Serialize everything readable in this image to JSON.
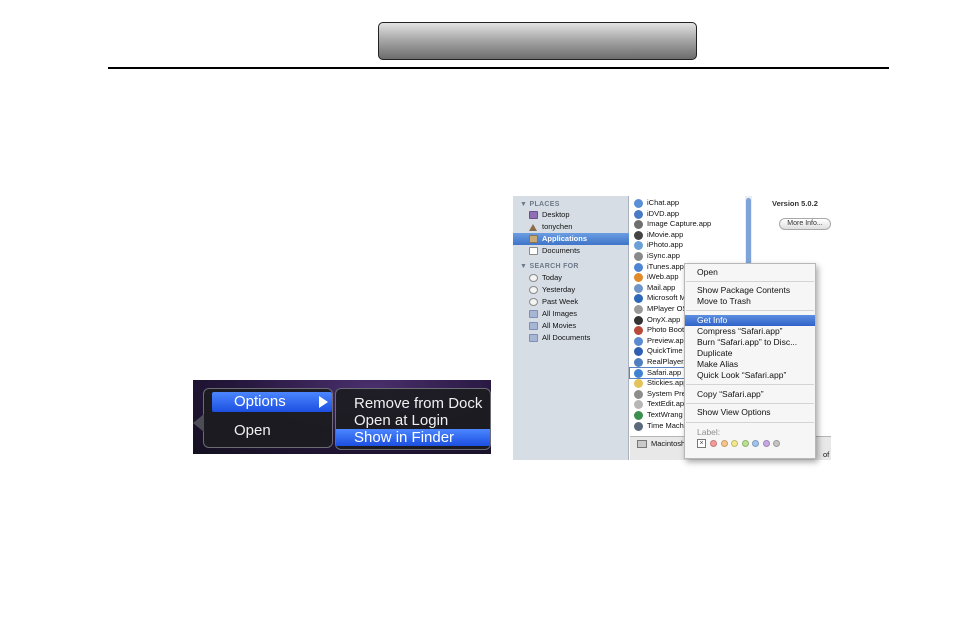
{
  "header": {
    "title": ""
  },
  "dock_menu": {
    "items": [
      "Options",
      "Open"
    ],
    "submenu": [
      "Remove from Dock",
      "Open at Login",
      "Show in Finder"
    ],
    "selected_submenu": "Show in Finder"
  },
  "finder": {
    "sidebar": {
      "places_heading": "▼ PLACES",
      "places": [
        "Desktop",
        "tonychen",
        "Applications",
        "Documents"
      ],
      "search_heading": "▼ SEARCH FOR",
      "search": [
        "Today",
        "Yesterday",
        "Past Week",
        "All Images",
        "All Movies",
        "All Documents"
      ]
    },
    "apps": [
      "iChat.app",
      "iDVD.app",
      "Image Capture.app",
      "iMovie.app",
      "iPhoto.app",
      "iSync.app",
      "iTunes.app",
      "iWeb.app",
      "Mail.app",
      "Microsoft M",
      "MPlayer OS",
      "OnyX.app",
      "Photo Boot",
      "Preview.app",
      "QuickTime",
      "RealPlayer.",
      "Safari.app",
      "Stickies.app",
      "System Pre",
      "TextEdit.ap",
      "TextWrang",
      "Time Machi"
    ],
    "path_item": "Macintosh",
    "path_suffix": "of",
    "version": "Version 5.0.2",
    "more_info": "More Info..."
  },
  "context_menu": {
    "items": [
      "Open",
      "Show Package Contents",
      "Move to Trash",
      "Get Info",
      "Compress “Safari.app”",
      "Burn “Safari.app” to Disc...",
      "Duplicate",
      "Make Alias",
      "Quick Look “Safari.app”",
      "Copy “Safari.app”",
      "Show View Options"
    ],
    "selected": "Get Info",
    "label_heading": "Label:",
    "label_colors": [
      "#f39a9a",
      "#f7c58a",
      "#f2e98c",
      "#b9e08c",
      "#9ec3ee",
      "#c8a8e4",
      "#c4c4c4"
    ]
  },
  "colors": {
    "accent": "#2f63c8",
    "dock_bg": "#24163b"
  }
}
